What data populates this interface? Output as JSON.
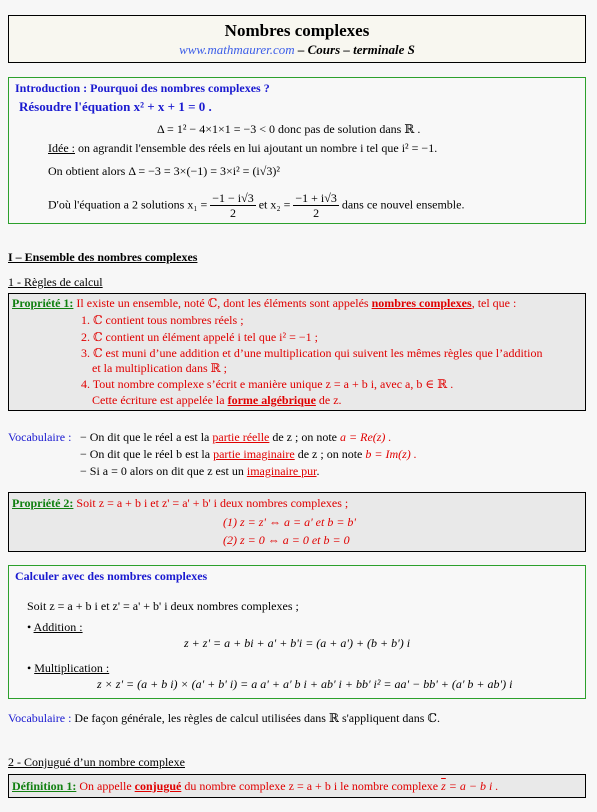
{
  "header": {
    "title": "Nombres complexes",
    "site": "www.mathmaurer.com",
    "subtitle": " – Cours – terminale S"
  },
  "intro": {
    "heading": "Introduction : Pourquoi des nombres complexes ?",
    "task": "Résoudre l'équation x² + x + 1 = 0 .",
    "delta_line": "Δ = 1² − 4×1×1 = −3 < 0  donc pas de solution dans ℝ .",
    "idea_label": "Idée :",
    "idea_text": " on agrandit l'ensemble des réels en lui ajoutant un nombre  i  tel que  i² = −1.",
    "obtain_line": "On obtient alors Δ = −3 = 3×(−1) = 3×i² = (i√3)²",
    "solutions_prefix": "D'où l'équation a 2 solutions  x₁ = ",
    "x1_num": "−1 − i√3",
    "x1_den": "2",
    "solutions_mid": "  et  x₂ = ",
    "x2_num": "−1 + i√3",
    "x2_den": "2",
    "solutions_suffix": "  dans ce nouvel ensemble."
  },
  "section1": {
    "heading": "I – Ensemble des nombres complexes",
    "sub1": "1 - Règles de calcul"
  },
  "prop1": {
    "label": "Propriété 1:",
    "intro": " Il existe un ensemble, noté ℂ,  dont les éléments sont appelés ",
    "term": "nombres complexes",
    "intro_end": ", tel que :",
    "items": [
      "1.  ℂ  contient tous nombres réels ;",
      "2.  ℂ  contient un élément appelé  i  tel que  i² = −1 ;",
      "3.  ℂ  est muni d’une addition et d’une multiplication qui suivent les mêmes règles que l’addition",
      "et la multiplication dans ℝ ;",
      "4. Tout nombre complexe s’écrit e manière unique  z = a + b i,  avec a, b ∈ ℝ ."
    ],
    "form_prefix": "Cette écriture est appelée la ",
    "form_term": "forme algébrique",
    "form_suffix": " de  z."
  },
  "vocab1": {
    "label": "Vocabulaire :",
    "lines": [
      {
        "a": " − On dit que le réel  a est la ",
        "term": "partie réelle",
        "b": "  de  z ; on note ",
        "formula": "a = Re(z) ."
      },
      {
        "a": "− On dit que le réel  b est la ",
        "term": "partie imaginaire",
        "b": "  de  z ; on note ",
        "formula": "b = Im(z) ."
      },
      {
        "a": "− Si  a = 0  alors on dit que  z  est un ",
        "term": "imaginaire pur",
        "b": ".",
        "formula": ""
      }
    ]
  },
  "prop2": {
    "label": "Propriété 2:",
    "text": " Soit  z = a + b i   et  z' = a' + b' i   deux nombres complexes ;",
    "eq1": "(1)  z = z' ⇔ a = a'  et  b = b'",
    "eq2": "(2)  z = 0 ⇔ a = 0  et  b = 0"
  },
  "calc": {
    "heading": "Calculer avec des nombres complexes",
    "let": "Soit  z = a + b i   et  z' = a' + b' i   deux nombres complexes ;",
    "add_label": "Addition :",
    "add_formula": "z + z' = a + bi + a' + b'i = (a + a') + (b + b') i",
    "mul_label": "Multiplication :",
    "mul_formula": "z × z' = (a + b i) × (a' + b' i) = a a' + a' b i + ab' i + bb' i² = aa' − bb' + (a' b + ab') i",
    "bullet": "•"
  },
  "vocab2": {
    "label": "Vocabulaire :",
    "text": " De façon générale, les règles  de calcul utilisées dans ℝ  s'appliquent dans ℂ."
  },
  "section2": {
    "sub2": "2 - Conjugué d’un nombre complexe"
  },
  "def1": {
    "label": "Définition 1:",
    "a": " On appelle ",
    "term": "conjugué",
    "b": " du nombre complexe  z = a + b i  le nombre complexe  ",
    "zbar": "z",
    "c": " = a − b i ."
  }
}
